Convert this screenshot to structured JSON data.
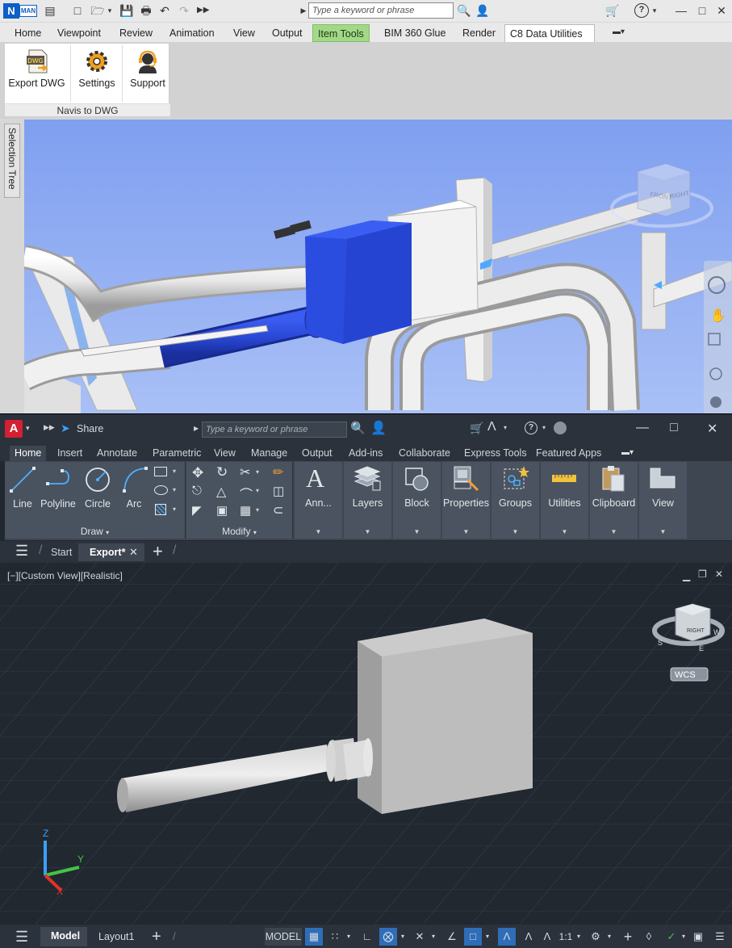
{
  "navis": {
    "logo": "N MAN",
    "search_placeholder": "Type a keyword or phrase",
    "tabs": [
      "Home",
      "Viewpoint",
      "Review",
      "Animation",
      "View",
      "Output",
      "Item Tools",
      "BIM 360 Glue",
      "Render",
      "C8 Data Utilities"
    ],
    "panel": {
      "buttons": [
        "Export DWG",
        "Settings",
        "Support"
      ],
      "label": "Navis to DWG",
      "dwg_badge": "DWG"
    },
    "side_tab": "Selection Tree",
    "viewcube": {
      "front": "FRONT",
      "right": "RIGHT"
    },
    "colors": {
      "selection_blue": "#2a4de0",
      "sky": "#8aa8ef",
      "item_tools_tab": "#a4d889"
    }
  },
  "autocad": {
    "logo": "A",
    "share_label": "Share",
    "search_placeholder": "Type a keyword or phrase",
    "tabs": [
      "Home",
      "Insert",
      "Annotate",
      "Parametric",
      "View",
      "Manage",
      "Output",
      "Add-ins",
      "Collaborate",
      "Express Tools",
      "Featured Apps"
    ],
    "draw": {
      "tools": [
        "Line",
        "Polyline",
        "Circle",
        "Arc"
      ],
      "label": "Draw"
    },
    "modify_label": "Modify",
    "big_buttons": [
      "Ann...",
      "Layers",
      "Block",
      "Properties",
      "Groups",
      "Utilities",
      "Clipboard",
      "View"
    ],
    "file_tabs": [
      "Start",
      "Export*"
    ],
    "viewport_label": "[−][Custom View][Realistic]",
    "viewcube": {
      "face": "RIGHT",
      "compass": [
        "W",
        "S",
        "E"
      ],
      "wcs": "WCS"
    },
    "ucs": {
      "z": "Z",
      "y": "Y"
    },
    "status": {
      "layout_tabs": [
        "Model",
        "Layout1"
      ],
      "model_label": "MODEL",
      "scale": "1:1"
    }
  }
}
